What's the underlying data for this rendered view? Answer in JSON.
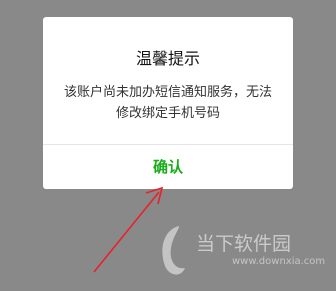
{
  "dialog": {
    "title": "温馨提示",
    "message_line1": "该账户尚未加办短信通知服务，无法",
    "message_line2": "修改绑定手机号码",
    "confirm_label": "确认"
  },
  "watermark": {
    "brand": "当下软件园",
    "url": "www.downxia.com"
  },
  "colors": {
    "overlay": "#898989",
    "confirm": "#1aad19",
    "arrow": "#e8212a"
  }
}
